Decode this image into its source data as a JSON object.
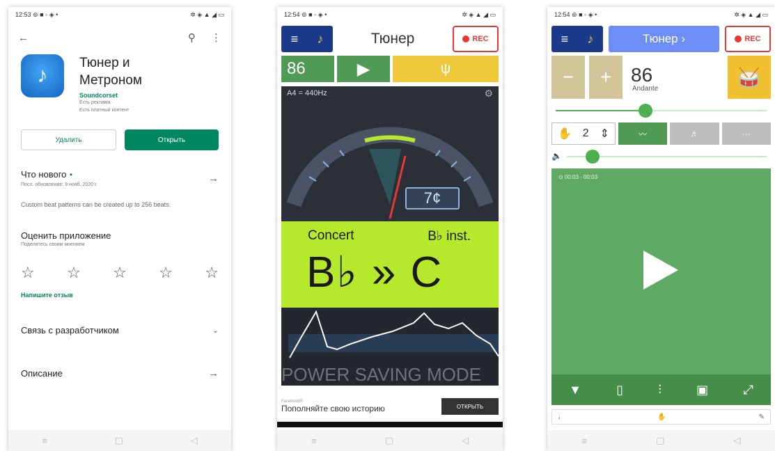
{
  "phone1": {
    "status": {
      "time": "12:53",
      "icons": "⊚ ■ ◦ ◈ •",
      "right": "✲ ◈ ▲ ◢ ▭"
    },
    "app": {
      "name_line1": "Тюнер и",
      "name_line2": "Метроном",
      "developer": "Soundcorset",
      "ads": "Есть реклама ·",
      "paid": "Есть платный контент"
    },
    "buttons": {
      "uninstall": "Удалить",
      "open": "Открыть"
    },
    "whats_new": {
      "title": "Что нового",
      "dot": "•",
      "updated": "Посл. обновление: 9 нояб. 2020 г.",
      "text": "Custom beat patterns can be created up to 256 beats."
    },
    "rate": {
      "title": "Оценить приложение",
      "subtitle": "Поделитесь своим мнением"
    },
    "review_link": "Напишите отзыв",
    "contact": "Связь с разработчиком",
    "description": "Описание"
  },
  "phone2": {
    "status": {
      "time": "12:54",
      "icons": "⊚ ■ ◦ ◈ •",
      "right": "✲ ◈ ▲ ◢ ▭"
    },
    "title": "Тюнер",
    "rec": "REC",
    "bpm": "86",
    "ref": "A4 = 440Hz",
    "cents": "7¢",
    "concert": "Concert",
    "inst": "B♭ inst.",
    "note": "B♭ » C",
    "power_saving": "POWER SAVING MODE",
    "ad": {
      "source": "Facebook®",
      "text": "Пополняйте свою историю",
      "open": "ОТКРЫТЬ"
    }
  },
  "phone3": {
    "status": {
      "time": "12:54",
      "icons": "⊚ ■ ◦ ◈ •",
      "right": "✲ ◈ ▲ ◢ ▭"
    },
    "tab": "Тюнер ›",
    "rec": "REC",
    "minus": "−",
    "plus": "+",
    "tempo": "86",
    "tempo_name": "Andante",
    "tempo_level": 0.42,
    "beats": "2",
    "volume_level": 0.1,
    "time": "⊙ 00:03 - 00:03",
    "more": "···"
  },
  "colors": {
    "accent_green": "#01875f",
    "tuner_green": "#b6e82c",
    "metronome_green": "#5faa62",
    "rec_red": "#e53935"
  }
}
